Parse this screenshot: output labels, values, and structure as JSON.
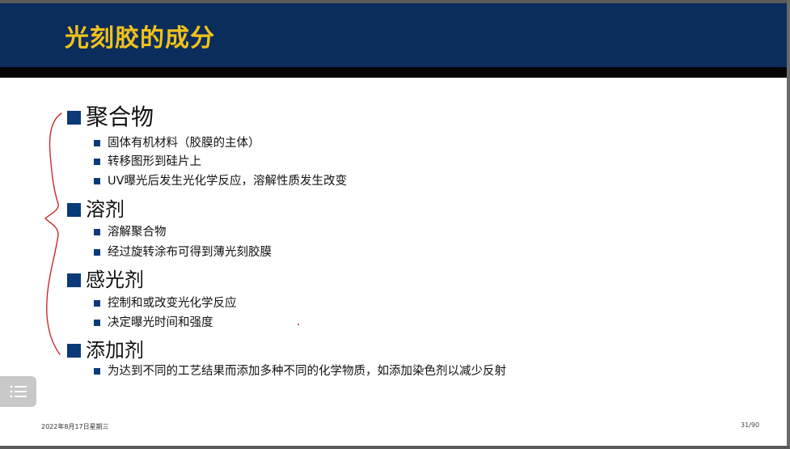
{
  "slide": {
    "title": "光刻胶的成分",
    "sections": [
      {
        "heading": "聚合物",
        "items": [
          "固体有机材料（胶膜的主体）",
          "转移图形到硅片上",
          "UV曝光后发生光化学反应，溶解性质发生改变"
        ]
      },
      {
        "heading": "溶剂",
        "items": [
          "溶解聚合物",
          "经过旋转涂布可得到薄光刻胶膜"
        ]
      },
      {
        "heading": "感光剂",
        "items": [
          "控制和或改变光化学反应",
          "决定曝光时间和强度"
        ]
      },
      {
        "heading": "添加剂",
        "items": [
          "为达到不同的工艺结果而添加多种不同的化学物质，如添加染色剂以减少反射"
        ]
      }
    ],
    "footer_date": "2022年8月17日星期三",
    "page_number": "31/90"
  },
  "colors": {
    "title_bar": "#0b2d5c",
    "title_text": "#f2c21a",
    "bullet": "#0b3a78",
    "annotation": "#c92a2a"
  },
  "icons": {
    "menu": "list-menu-icon"
  }
}
